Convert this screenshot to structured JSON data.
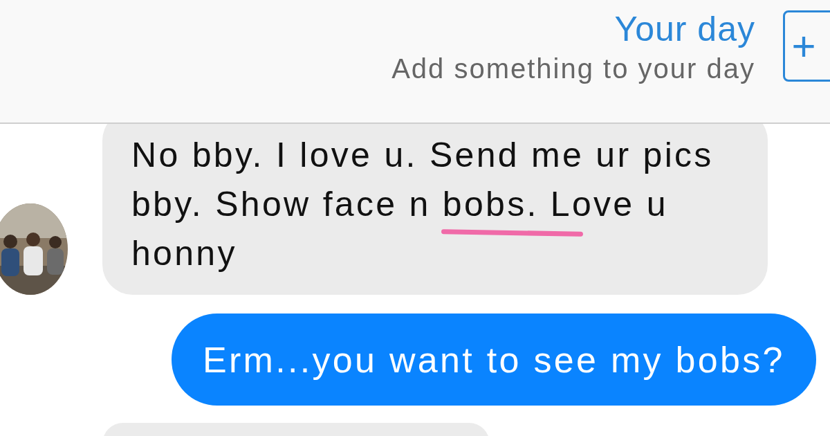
{
  "header": {
    "title": "Your day",
    "subtitle": "Add something to your day",
    "add_button": "+"
  },
  "messages": [
    {
      "kind": "received",
      "text": "No bby. I love u. Send me ur pics bby. Show face n bobs. Love u honny",
      "underlined": true
    },
    {
      "kind": "sent",
      "text": "Erm...you want to see my bobs?"
    },
    {
      "kind": "received"
    }
  ]
}
